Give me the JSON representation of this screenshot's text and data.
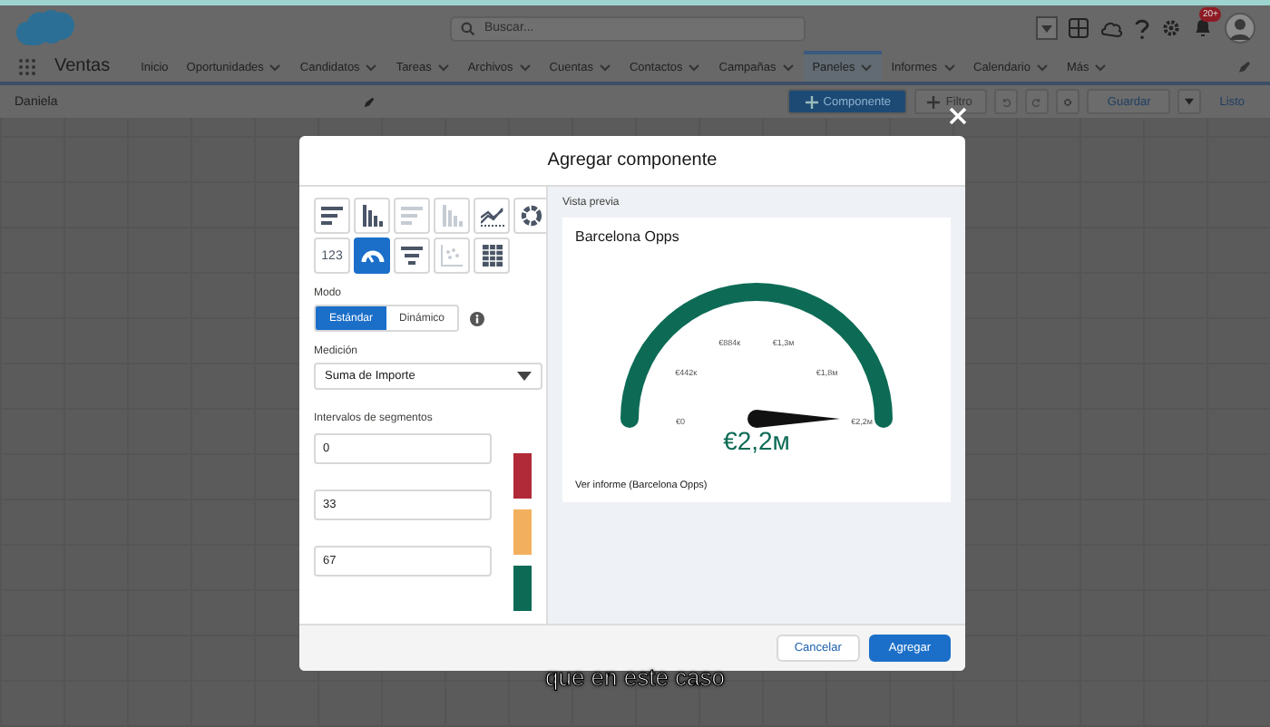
{
  "header": {
    "search": {
      "placeholder": "Buscar..."
    },
    "notifications": "20+"
  },
  "nav": {
    "app_name": "Ventas",
    "items": [
      {
        "label": "Inicio",
        "menu": false,
        "selected": false
      },
      {
        "label": "Oportunidades",
        "menu": true,
        "selected": false
      },
      {
        "label": "Candidatos",
        "menu": true,
        "selected": false
      },
      {
        "label": "Tareas",
        "menu": true,
        "selected": false
      },
      {
        "label": "Archivos",
        "menu": true,
        "selected": false
      },
      {
        "label": "Cuentas",
        "menu": true,
        "selected": false
      },
      {
        "label": "Contactos",
        "menu": true,
        "selected": false
      },
      {
        "label": "Campañas",
        "menu": true,
        "selected": false
      },
      {
        "label": "Paneles",
        "menu": true,
        "selected": true
      },
      {
        "label": "Informes",
        "menu": true,
        "selected": false
      },
      {
        "label": "Calendario",
        "menu": true,
        "selected": false
      },
      {
        "label": "Más",
        "menu": true,
        "selected": false
      }
    ]
  },
  "dashboard_bar": {
    "name": "Daniela",
    "add_component": "Componente",
    "filter": "Filtro",
    "save": "Guardar",
    "done": "Listo"
  },
  "modal": {
    "title": "Agregar componente",
    "chart_types": [
      {
        "kind": "hbar",
        "selected": false,
        "disabled": false
      },
      {
        "kind": "vbar",
        "selected": false,
        "disabled": false
      },
      {
        "kind": "hbar",
        "selected": false,
        "disabled": true
      },
      {
        "kind": "vbar",
        "selected": false,
        "disabled": true
      },
      {
        "kind": "line",
        "selected": false,
        "disabled": false
      },
      {
        "kind": "donut",
        "selected": false,
        "disabled": false
      },
      {
        "kind": "metric",
        "label": "123",
        "selected": false,
        "disabled": false
      },
      {
        "kind": "gauge",
        "selected": true,
        "disabled": false
      },
      {
        "kind": "funnel",
        "selected": false,
        "disabled": false
      },
      {
        "kind": "scatter",
        "selected": false,
        "disabled": true
      },
      {
        "kind": "table",
        "selected": false,
        "disabled": false
      }
    ],
    "mode_label": "Modo",
    "modes": [
      {
        "label": "Estándar",
        "selected": true
      },
      {
        "label": "Dinámico",
        "selected": false
      }
    ],
    "measure_label": "Medición",
    "measure": "Suma de Importe",
    "segments_label": "Intervalos de segmentos",
    "segments": [
      {
        "value": "0",
        "color": "#b02a37"
      },
      {
        "value": "33",
        "color": "#f2b05e"
      },
      {
        "value": "67",
        "color": "#0d6b55"
      }
    ],
    "preview": {
      "label": "Vista previa",
      "title": "Barcelona Opps",
      "gauge": {
        "ticks": [
          "€0",
          "€442к",
          "€884к",
          "€1,3м",
          "€1,8м",
          "€2,2м"
        ],
        "value": "€2,2м"
      },
      "link": "Ver informe (Barcelona Opps)"
    },
    "buttons": [
      {
        "label": "Cancelar",
        "primary": false
      },
      {
        "label": "Agregar",
        "primary": true
      }
    ]
  },
  "caption": "que en este caso"
}
